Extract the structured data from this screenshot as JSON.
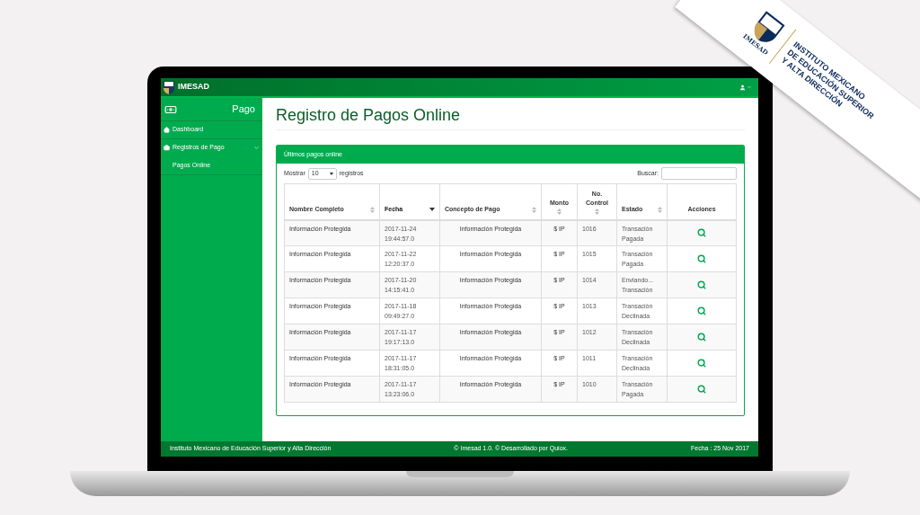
{
  "topbar": {
    "brand": "IMESAD"
  },
  "sidebar": {
    "header": "Pago",
    "items": [
      {
        "kind": "link",
        "label": "Dashboard"
      },
      {
        "kind": "group",
        "label": "Registros de Pago",
        "expanded": true,
        "children": [
          {
            "label": "Pagos Online"
          }
        ]
      }
    ]
  },
  "page_title": "Registro de Pagos Online",
  "card": {
    "title": "Últimos pagos online",
    "length": {
      "before": "Mostrar",
      "value": "10",
      "after": "registros"
    },
    "search": {
      "label": "Buscar:"
    },
    "table": {
      "columns": [
        {
          "label": "Nombre Completo",
          "sortable": true,
          "sorted": false
        },
        {
          "label": "Fecha",
          "sortable": true,
          "sorted": true
        },
        {
          "label": "Concepto de Pago",
          "sortable": true,
          "sorted": false
        },
        {
          "label": "Monto",
          "sortable": true,
          "sorted": false
        },
        {
          "label": "No. Control",
          "sortable": true,
          "sorted": false
        },
        {
          "label": "Estado",
          "sortable": true,
          "sorted": false
        },
        {
          "label": "Acciones",
          "sortable": false,
          "sorted": false
        }
      ],
      "rows": [
        {
          "cells": [
            "Información Protegida",
            "2017-11-24 19:44:57.0",
            "Información Protegida",
            "$ IP",
            "1016",
            "Transación Pagada"
          ]
        },
        {
          "cells": [
            "Información Protegida",
            "2017-11-22 12:20:37.0",
            "Información Protegida",
            "$ IP",
            "1015",
            "Transación Pagada"
          ]
        },
        {
          "cells": [
            "Información Protegida",
            "2017-11-20 14:15:41.0",
            "Información Protegida",
            "$ IP",
            "1014",
            "Enviando... Transación"
          ]
        },
        {
          "cells": [
            "Información Protegida",
            "2017-11-18 09:49:27.0",
            "Información Protegida",
            "$ IP",
            "1013",
            "Transación Declinada"
          ]
        },
        {
          "cells": [
            "Información Protegida",
            "2017-11-17 19:17:13.0",
            "Información Protegida",
            "$ IP",
            "1012",
            "Transación Declinada"
          ]
        },
        {
          "cells": [
            "Información Protegida",
            "2017-11-17 18:31:05.0",
            "Información Protegida",
            "$ IP",
            "1011",
            "Transación Declinada"
          ]
        },
        {
          "cells": [
            "Información Protegida",
            "2017-11-17 13:23:06.0",
            "Información Protegida",
            "$ IP",
            "1010",
            "Transación Pagada"
          ]
        }
      ]
    }
  },
  "footer": {
    "left": "Instituto Mexicano de Educación Superior y Alta Dirección",
    "center": "© Imesad 1.0. © Desarrollado por Quiox.",
    "right": "Fecha : 25 Nov 2017"
  },
  "banner": {
    "logo_text": "IMESAD",
    "lines": [
      "INSTITUTO MEXICANO",
      "DE EDUCACIÓN SUPERIOR",
      "Y ALTA DIRECCIÓN"
    ]
  }
}
